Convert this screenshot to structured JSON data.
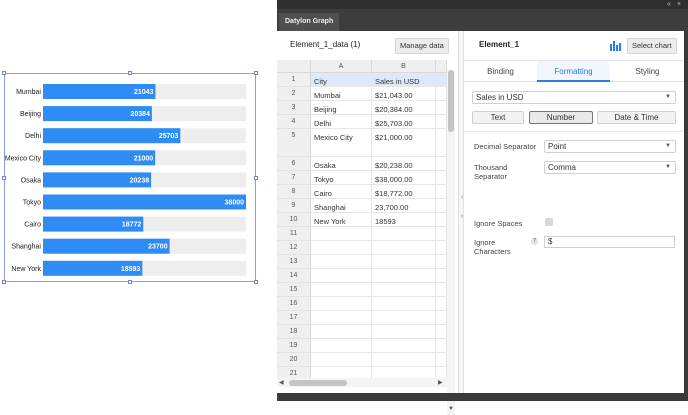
{
  "chart_data": {
    "type": "bar",
    "categories": [
      "Mumbai",
      "Beijing",
      "Delhi",
      "Mexico City",
      "Osaka",
      "Tokyo",
      "Cairo",
      "Shanghai",
      "New York"
    ],
    "values": [
      21043,
      20384,
      25703,
      21000,
      20238,
      38000,
      18772,
      23700,
      18593
    ],
    "value_labels": [
      "21043",
      "20384",
      "25703",
      "21000",
      "20238",
      "38000",
      "18772",
      "23700",
      "18593"
    ],
    "xlim": [
      0,
      38000
    ],
    "bar_color": "#2f8cf5",
    "track_color": "#eeeeee"
  },
  "window": {
    "tab_title": "Datylon Graph",
    "controls": [
      "«",
      "×"
    ]
  },
  "data_panel": {
    "title": "Element_1_data (1)",
    "manage_button": "Manage data",
    "columns": [
      "A",
      "B"
    ],
    "rows": [
      {
        "n": "1",
        "a": "City",
        "b": "Sales in USD"
      },
      {
        "n": "2",
        "a": "Mumbai",
        "b": "$21,043.00"
      },
      {
        "n": "3",
        "a": "Beijing",
        "b": "$20,384.00"
      },
      {
        "n": "4",
        "a": "Delhi",
        "b": "$25,703.00"
      },
      {
        "n": "5",
        "a": "Mexico City",
        "b": "$21,000.00"
      },
      {
        "n": "6",
        "a": "Osaka",
        "b": "$20,238.00"
      },
      {
        "n": "7",
        "a": "Tokyo",
        "b": "$38,000.00"
      },
      {
        "n": "8",
        "a": "Cairo",
        "b": "$18,772.00"
      },
      {
        "n": "9",
        "a": "Shanghai",
        "b": "23,700.00"
      },
      {
        "n": "10",
        "a": "New York",
        "b": "18593"
      },
      {
        "n": "11",
        "a": "",
        "b": ""
      },
      {
        "n": "12",
        "a": "",
        "b": ""
      },
      {
        "n": "13",
        "a": "",
        "b": ""
      },
      {
        "n": "14",
        "a": "",
        "b": ""
      },
      {
        "n": "15",
        "a": "",
        "b": ""
      },
      {
        "n": "16",
        "a": "",
        "b": ""
      },
      {
        "n": "17",
        "a": "",
        "b": ""
      },
      {
        "n": "18",
        "a": "",
        "b": ""
      },
      {
        "n": "19",
        "a": "",
        "b": ""
      },
      {
        "n": "20",
        "a": "",
        "b": ""
      },
      {
        "n": "21",
        "a": "",
        "b": ""
      }
    ]
  },
  "settings": {
    "element_name": "Element_1",
    "select_chart_button": "Select chart",
    "tabs": [
      "Binding",
      "Formatting",
      "Styling"
    ],
    "active_tab": "Formatting",
    "column_dropdown": "Sales in USD",
    "type_options": [
      "Text",
      "Number",
      "Date & Time"
    ],
    "active_type": "Number",
    "decimal_separator_label": "Decimal Separator",
    "decimal_separator_value": "Point",
    "thousand_separator_label": "Thousand Separator",
    "thousand_separator_value": "Comma",
    "ignore_spaces_label": "Ignore Spaces",
    "ignore_characters_label": "Ignore Characters",
    "ignore_characters_value": "$",
    "help_icon_text": "?",
    "accent_color": "#2a7de1"
  }
}
